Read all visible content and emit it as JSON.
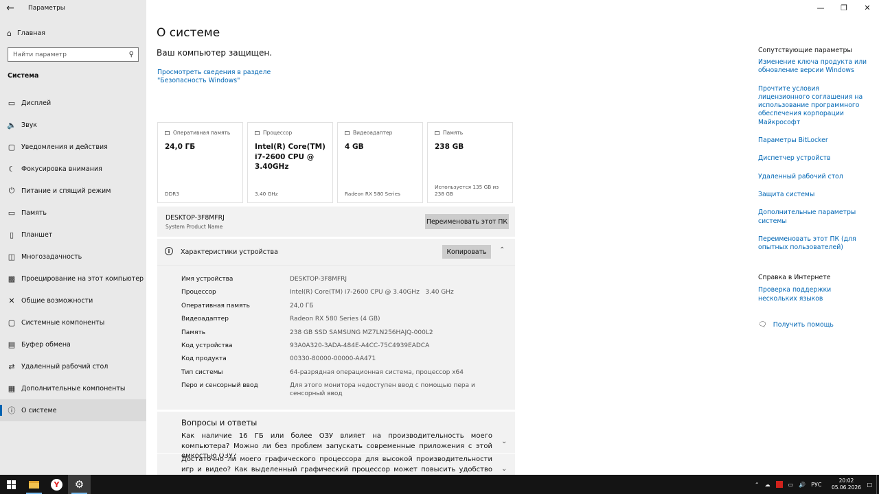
{
  "sidebar": {
    "app_title": "Параметры",
    "home_label": "Главная",
    "search_placeholder": "Найти параметр",
    "section_title": "Система",
    "items": [
      {
        "label": "Дисплей"
      },
      {
        "label": "Звук"
      },
      {
        "label": "Уведомления и действия"
      },
      {
        "label": "Фокусировка внимания"
      },
      {
        "label": "Питание и спящий режим"
      },
      {
        "label": "Память"
      },
      {
        "label": "Планшет"
      },
      {
        "label": "Многозадачность"
      },
      {
        "label": "Проецирование на этот компьютер"
      },
      {
        "label": "Общие возможности"
      },
      {
        "label": "Системные компоненты"
      },
      {
        "label": "Буфер обмена"
      },
      {
        "label": "Удаленный рабочий стол"
      },
      {
        "label": "Дополнительные компоненты"
      },
      {
        "label": "О системе"
      }
    ]
  },
  "main": {
    "title": "О системе",
    "protected_text": "Ваш компьютер защищен.",
    "security_link": "Просмотреть сведения в разделе \"Безопасность Windows\"",
    "cards": [
      {
        "caption": "Оперативная память",
        "value": "24,0 ГБ",
        "sub": "DDR3"
      },
      {
        "caption": "Процессор",
        "value": "Intel(R) Core(TM) i7-2600 CPU @ 3.40GHz",
        "sub": "3.40 GHz"
      },
      {
        "caption": "Видеоадаптер",
        "value": "4 GB",
        "sub": "Radeon RX 580 Series"
      },
      {
        "caption": "Память",
        "value": "238 GB",
        "sub": "Используется 135 GB из 238 GB"
      }
    ],
    "pc_name": "DESKTOP-3F8MFRJ",
    "pc_name_sub": "System Product Name",
    "rename_button": "Переименовать этот ПК",
    "specs": {
      "title": "Характеристики устройства",
      "copy_button": "Копировать",
      "rows": [
        {
          "key": "Имя устройства",
          "value": "DESKTOP-3F8MFRJ"
        },
        {
          "key": "Процессор",
          "value": "Intel(R) Core(TM) i7-2600 CPU @ 3.40GHz   3.40 GHz"
        },
        {
          "key": "Оперативная память",
          "value": "24,0 ГБ"
        },
        {
          "key": "Видеоадаптер",
          "value": "Radeon RX 580 Series (4 GB)"
        },
        {
          "key": "Память",
          "value": "238 GB SSD SAMSUNG MZ7LN256HAJQ-000L2"
        },
        {
          "key": "Код устройства",
          "value": "93A0A320-3ADA-484E-A4CC-75C4939EADCA"
        },
        {
          "key": "Код продукта",
          "value": "00330-80000-00000-AA471"
        },
        {
          "key": "Тип системы",
          "value": "64-разрядная операционная система, процессор x64"
        },
        {
          "key": "Перо и сенсорный ввод",
          "value": "Для этого монитора недоступен ввод с помощью пера и сенсорный ввод"
        }
      ]
    },
    "faq": {
      "title": "Вопросы и ответы",
      "q1": "Как наличие 16 ГБ или более ОЗУ влияет на производительность моего компьютера? Можно ли без проблем запускать современные приложения с этой емкостью ОЗУ?",
      "q2": "Достаточно ли моего графического процессора для высокой производительности игр и видео? Как выделенный графический процессор может повысить удобство работы и"
    }
  },
  "related": {
    "heading": "Сопутствующие параметры",
    "links": [
      "Изменение ключа продукта или обновление версии Windows",
      "Прочтите условия лицензионного соглашения на использование программного обеспечения корпорации Майкрософт",
      "Параметры BitLocker",
      "Диспетчер устройств",
      "Удаленный рабочий стол",
      "Защита системы",
      "Дополнительные параметры системы",
      "Переименовать этот ПК (для опытных пользователей)"
    ],
    "web_heading": "Справка в Интернете",
    "web_links": [
      "Проверка поддержки нескольких языков"
    ],
    "get_help": "Получить помощь"
  },
  "taskbar": {
    "lang": "РУС",
    "time": "20:02",
    "date": "05.06.2026"
  },
  "icons": {
    "back": "arrow-left-icon",
    "home": "home-icon",
    "search": "search-icon"
  },
  "colors": {
    "accent": "#0063b1",
    "link": "#0066b4",
    "sidebar_bg": "#e9e9e9",
    "taskbar_bg": "#141414"
  }
}
